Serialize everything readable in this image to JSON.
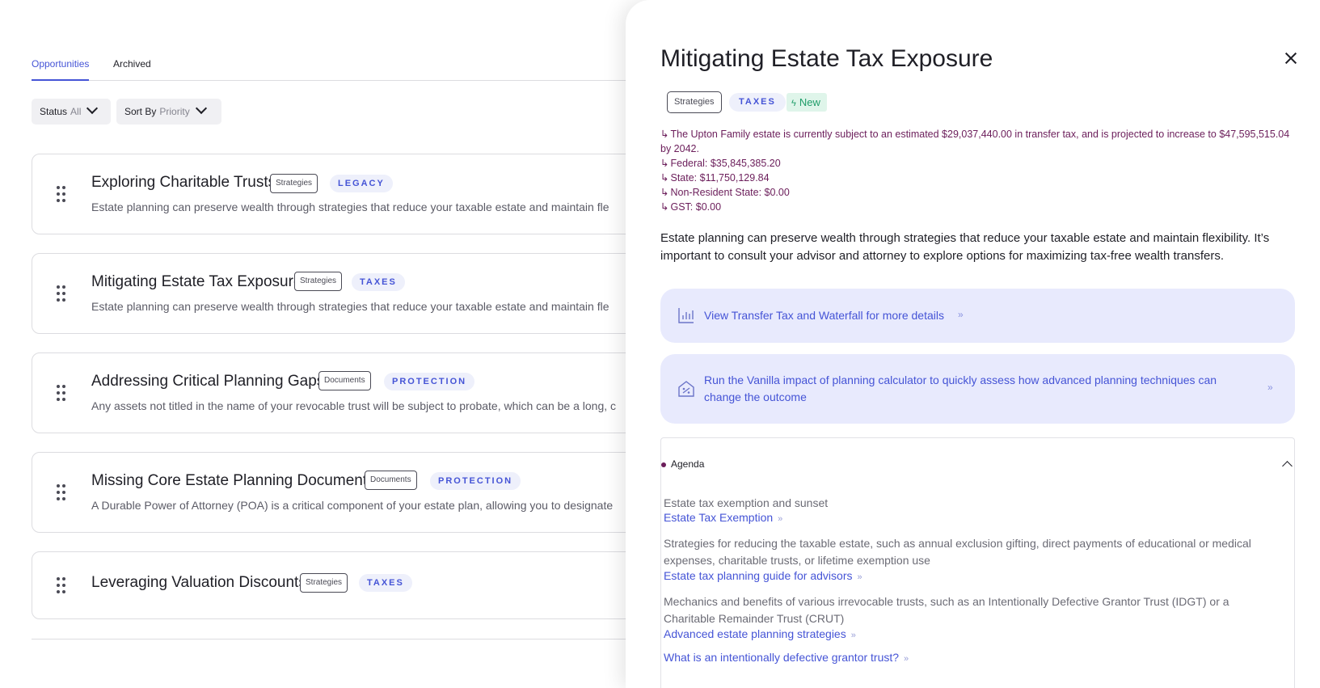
{
  "tabs": {
    "opportunities": "Opportunities",
    "archived": "Archived"
  },
  "filters": {
    "status_label": "Status",
    "status_value": "All",
    "sort_label": "Sort By",
    "sort_value": "Priority"
  },
  "cards": [
    {
      "title": "Exploring Charitable Trusts",
      "chip": "Strategies",
      "category": "LEGACY",
      "description": "Estate planning can preserve wealth through strategies that reduce your taxable estate and maintain fle"
    },
    {
      "title": "Mitigating Estate Tax Exposure",
      "chip": "Strategies",
      "category": "TAXES",
      "description": "Estate planning can preserve wealth through strategies that reduce your taxable estate and maintain fle"
    },
    {
      "title": "Addressing Critical Planning Gaps",
      "chip": "Documents",
      "category": "PROTECTION",
      "description": "Any assets not titled in the name of your revocable trust will be subject to probate, which can be a long, c"
    },
    {
      "title": "Missing Core Estate Planning Documents",
      "chip": "Documents",
      "category": "PROTECTION",
      "description": "A Durable Power of Attorney (POA) is a critical component of your estate plan, allowing you to designate"
    },
    {
      "title": "Leveraging Valuation Discounts",
      "chip": "Strategies",
      "category": "TAXES",
      "description": ""
    }
  ],
  "drawer": {
    "title": "Mitigating Estate Tax Exposure",
    "chip": "Strategies",
    "category": "TAXES",
    "new_badge": "New",
    "tax_lines": [
      "The Upton Family estate is currently subject to an estimated $29,037,440.00 in transfer tax, and is projected to increase to $47,595,515.04 by 2042.",
      "Federal: $35,845,385.20",
      "State: $11,750,129.84",
      "Non-Resident State: $0.00",
      "GST: $0.00"
    ],
    "body": "Estate planning can preserve wealth through strategies that reduce your taxable estate and maintain flexibility. It’s important to consult your advisor and attorney to explore options for maximizing tax-free wealth transfers.",
    "action_1": "View Transfer Tax and Waterfall for more details",
    "action_2": "Run the Vanilla impact of planning calculator to quickly assess how advanced planning techniques can change the outcome",
    "agenda": {
      "label": "Agenda",
      "items": [
        {
          "text": "Estate tax exemption and sunset",
          "links": [
            "Estate Tax Exemption"
          ]
        },
        {
          "text": "Strategies for reducing the taxable estate, such as annual exclusion gifting, direct payments of educational or medical expenses, charitable trusts, or lifetime exemption use",
          "links": [
            "Estate tax planning guide for advisors"
          ]
        },
        {
          "text": "Mechanics and benefits of various irrevocable trusts, such as an Intentionally Defective Grantor Trust (IDGT) or a Charitable Remainder Trust (CRUT)",
          "links": [
            "Advanced estate planning strategies",
            "What is an intentionally defective grantor trust?"
          ]
        }
      ]
    }
  },
  "colors": {
    "accent": "#4554d6",
    "action_bg": "#e8eafd",
    "tax_text": "#6b1d5a",
    "new_badge_bg": "#dff5ea",
    "new_badge_text": "#1f9d69"
  },
  "icons": {
    "close": "close-icon",
    "drag": "drag-handle-icon",
    "chart": "bar-chart-icon",
    "calculator": "calculator-icon",
    "bolt": "bolt-icon",
    "chevron_down": "chevron-down-icon",
    "chevron_up": "chevron-up-icon",
    "double_chevron": "double-chevron-right-icon",
    "return_arrow": "return-arrow-icon"
  }
}
